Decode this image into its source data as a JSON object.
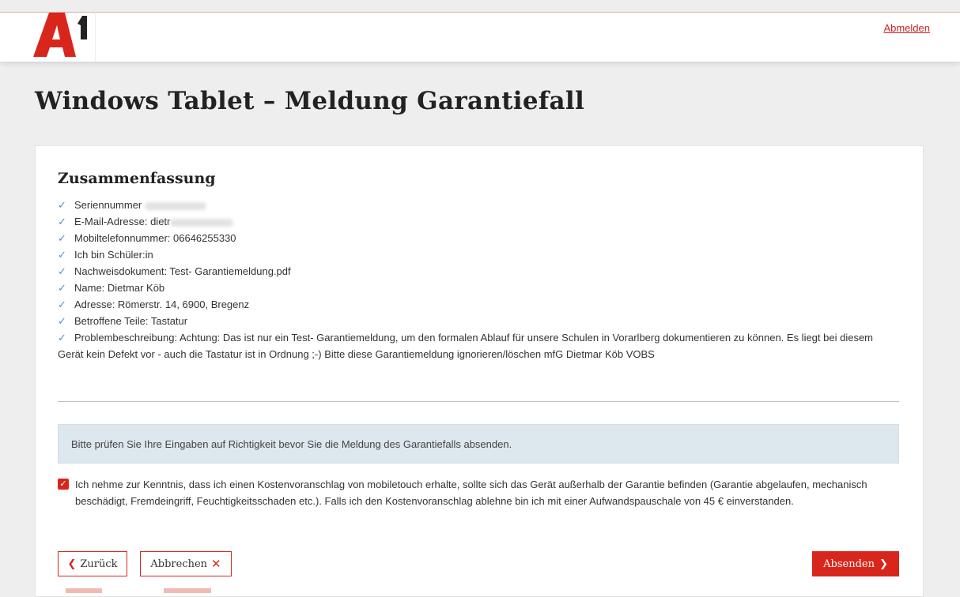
{
  "header": {
    "logout_label": "Abmelden",
    "brand_color": "#d9261c"
  },
  "page": {
    "title": "Windows Tablet – Meldung Garantiefall"
  },
  "summary": {
    "title": "Zusammenfassung",
    "items": [
      "Seriennummer",
      "E-Mail-Adresse: dietr",
      "Mobiltelefonnummer: 06646255330",
      "Ich bin Schüler:in",
      "Nachweisdokument: Test- Garantiemeldung.pdf",
      "Name: Dietmar Köb",
      "Adresse: Römerstr. 14, 6900, Bregenz",
      "Betroffene Teile: Tastatur",
      "Problembeschreibung: Achtung: Das ist nur ein Test- Garantiemeldung, um den formalen Ablauf für unsere Schulen in Vorarlberg dokumentieren zu können. Es liegt bei diesem Gerät kein Defekt vor - auch die Tastatur ist in Ordnung ;-) Bitte diese Garantiemeldung ignorieren/löschen mfG Dietmar Köb VOBS"
    ]
  },
  "notice": {
    "text": "Bitte prüfen Sie Ihre Eingaben auf Richtigkeit bevor Sie die Meldung des Garantiefalls absenden."
  },
  "consent": {
    "checked": true,
    "text": "Ich nehme zur Kenntnis, dass ich einen Kostenvoranschlag von mobiletouch erhalte, sollte sich das Gerät außerhalb der Garantie befinden (Garantie abgelaufen, mechanisch beschädigt, Fremdeingriff, Feuchtigkeitsschaden etc.). Falls ich den Kostenvoranschlag ablehne bin ich mit einer Aufwandspauschale von 45 € einverstanden."
  },
  "actions": {
    "back_label": "Zurück",
    "cancel_label": "Abbrechen",
    "submit_label": "Absenden"
  }
}
